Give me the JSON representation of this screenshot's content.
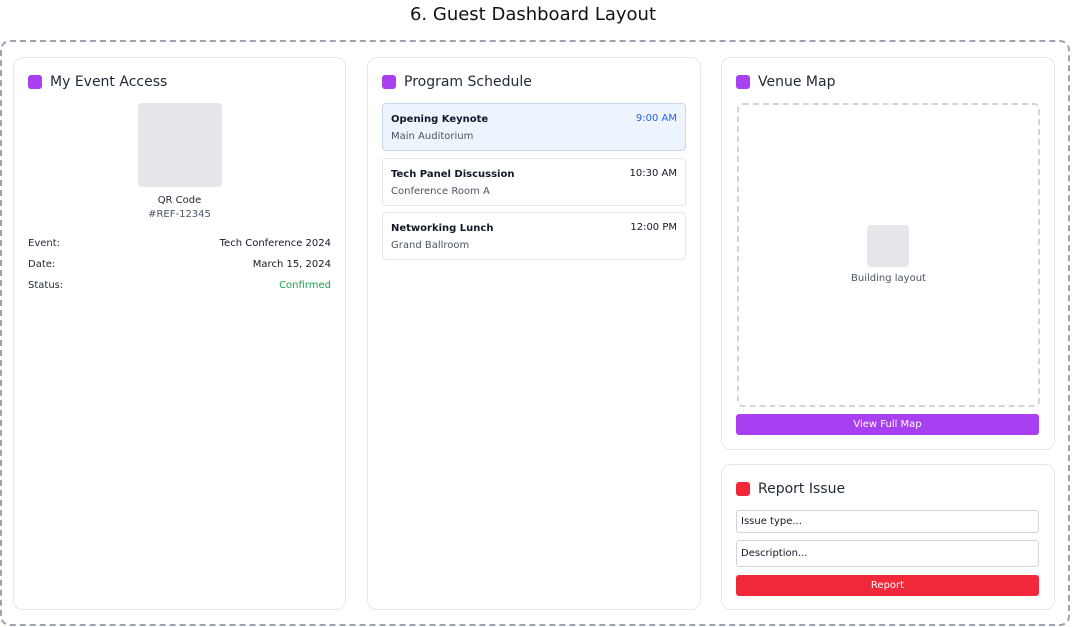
{
  "page": {
    "title": "6. Guest Dashboard Layout"
  },
  "access": {
    "title": "My Event Access",
    "qr_label": "QR Code",
    "qr_ref": "#REF-12345",
    "rows": [
      {
        "key": "Event:",
        "value": "Tech Conference 2024"
      },
      {
        "key": "Date:",
        "value": "March 15, 2024"
      },
      {
        "key": "Status:",
        "value": "Confirmed"
      }
    ]
  },
  "schedule": {
    "title": "Program Schedule",
    "items": [
      {
        "name": "Opening Keynote",
        "time": "9:00 AM",
        "location": "Main Auditorium"
      },
      {
        "name": "Tech Panel Discussion",
        "time": "10:30 AM",
        "location": "Conference Room A"
      },
      {
        "name": "Networking Lunch",
        "time": "12:00 PM",
        "location": "Grand Ballroom"
      }
    ]
  },
  "map": {
    "title": "Venue Map",
    "placeholder": "Building layout",
    "button_label": "View Full Map"
  },
  "report": {
    "title": "Report Issue",
    "issue_type_placeholder": "Issue type...",
    "description_placeholder": "Description...",
    "button_label": "Report"
  },
  "colors": {
    "accent_purple": "#a83ff0",
    "accent_red": "#f0283a",
    "status_green": "#16a34a",
    "active_time_blue": "#2563eb"
  }
}
